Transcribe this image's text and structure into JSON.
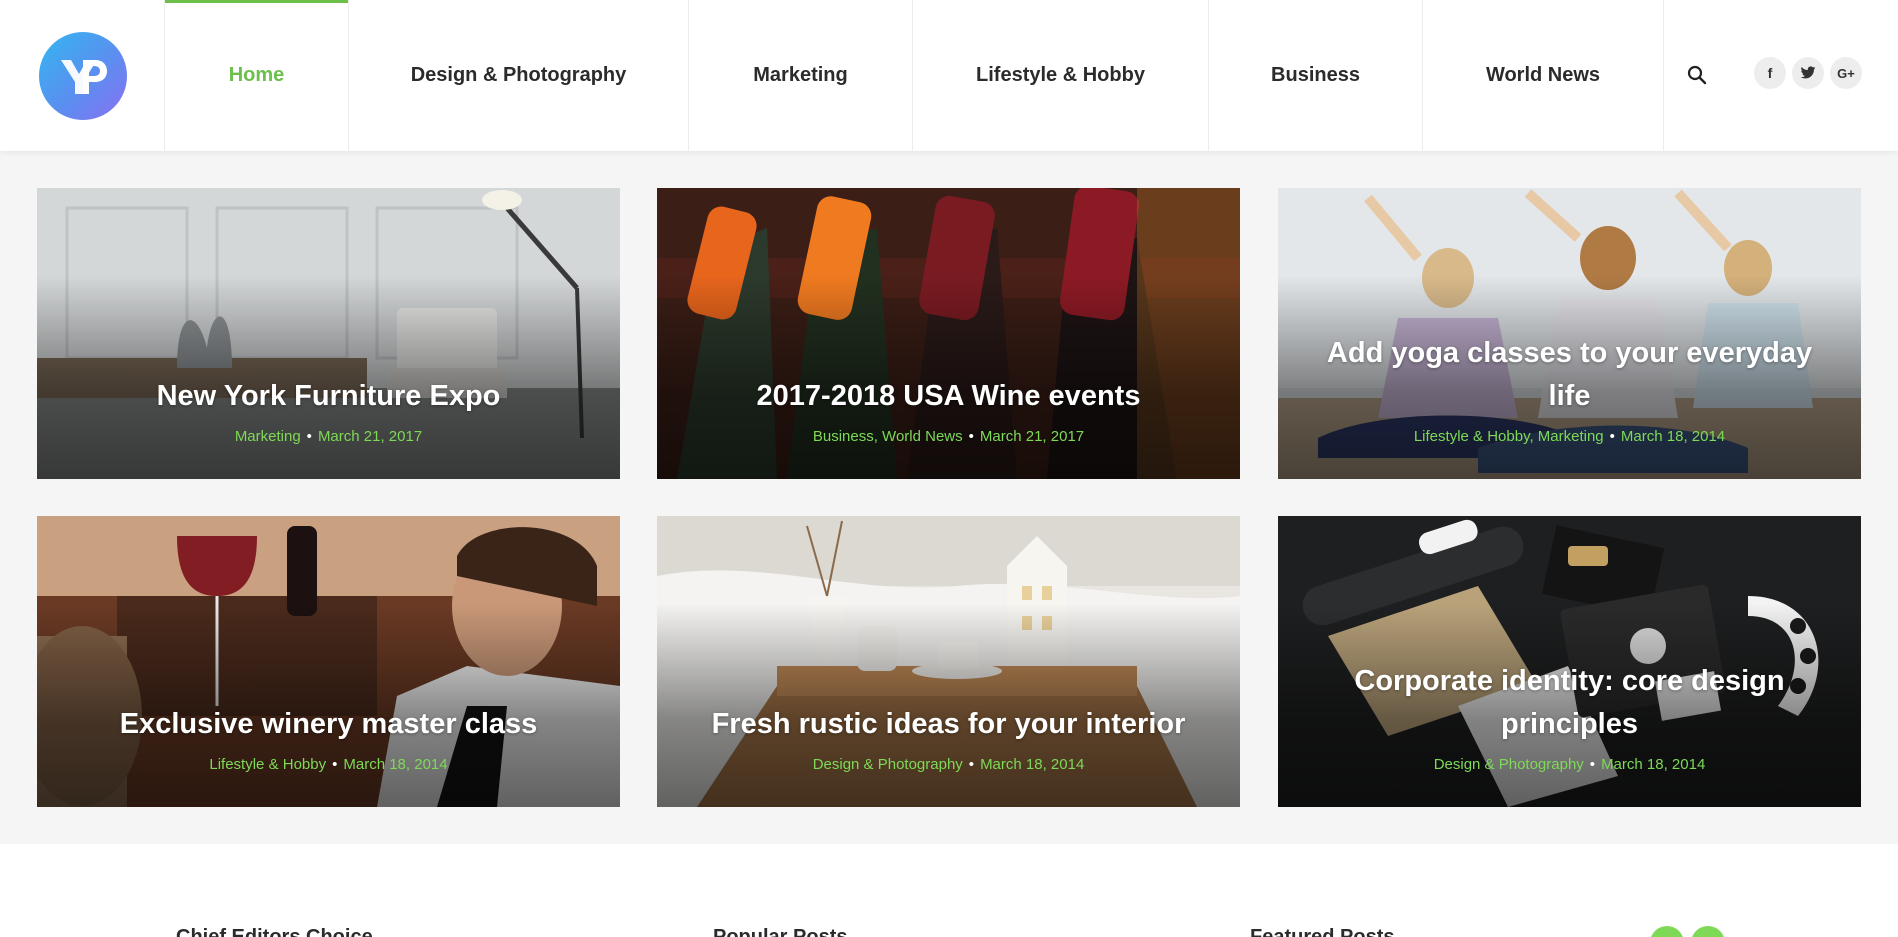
{
  "brand": {
    "logo_letters": "YP"
  },
  "nav": {
    "items": [
      {
        "label": "Home",
        "active": true
      },
      {
        "label": "Design & Photography",
        "active": false
      },
      {
        "label": "Marketing",
        "active": false
      },
      {
        "label": "Lifestyle & Hobby",
        "active": false
      },
      {
        "label": "Business",
        "active": false
      },
      {
        "label": "World News",
        "active": false
      }
    ],
    "search_icon": "search-icon",
    "social": [
      {
        "name": "facebook-icon",
        "glyph": "f"
      },
      {
        "name": "twitter-icon",
        "glyph": "t"
      },
      {
        "name": "google-plus-icon",
        "glyph": "G+"
      }
    ]
  },
  "posts": [
    {
      "title": "New York Furniture Expo",
      "categories": "Marketing",
      "date": "March 21, 2017"
    },
    {
      "title": "2017-2018 USA Wine events",
      "categories": "Business, World News",
      "date": "March 21, 2017"
    },
    {
      "title": "Add yoga classes to your everyday life",
      "categories": "Lifestyle & Hobby, Marketing",
      "date": "March 18, 2014"
    },
    {
      "title": "Exclusive winery master class",
      "categories": "Lifestyle & Hobby",
      "date": "March 18, 2014"
    },
    {
      "title": "Fresh rustic ideas for your interior",
      "categories": "Design & Photography",
      "date": "March 18, 2014"
    },
    {
      "title": "Corporate identity: core design principles",
      "categories": "Design & Photography",
      "date": "March 18, 2014"
    }
  ],
  "footer": {
    "headings": [
      "Chief Editors Choice",
      "Popular Posts",
      "Featured Posts"
    ]
  },
  "colors": {
    "accent": "#6cc04a",
    "meta": "#7ed957",
    "text": "#2b2b2b"
  }
}
